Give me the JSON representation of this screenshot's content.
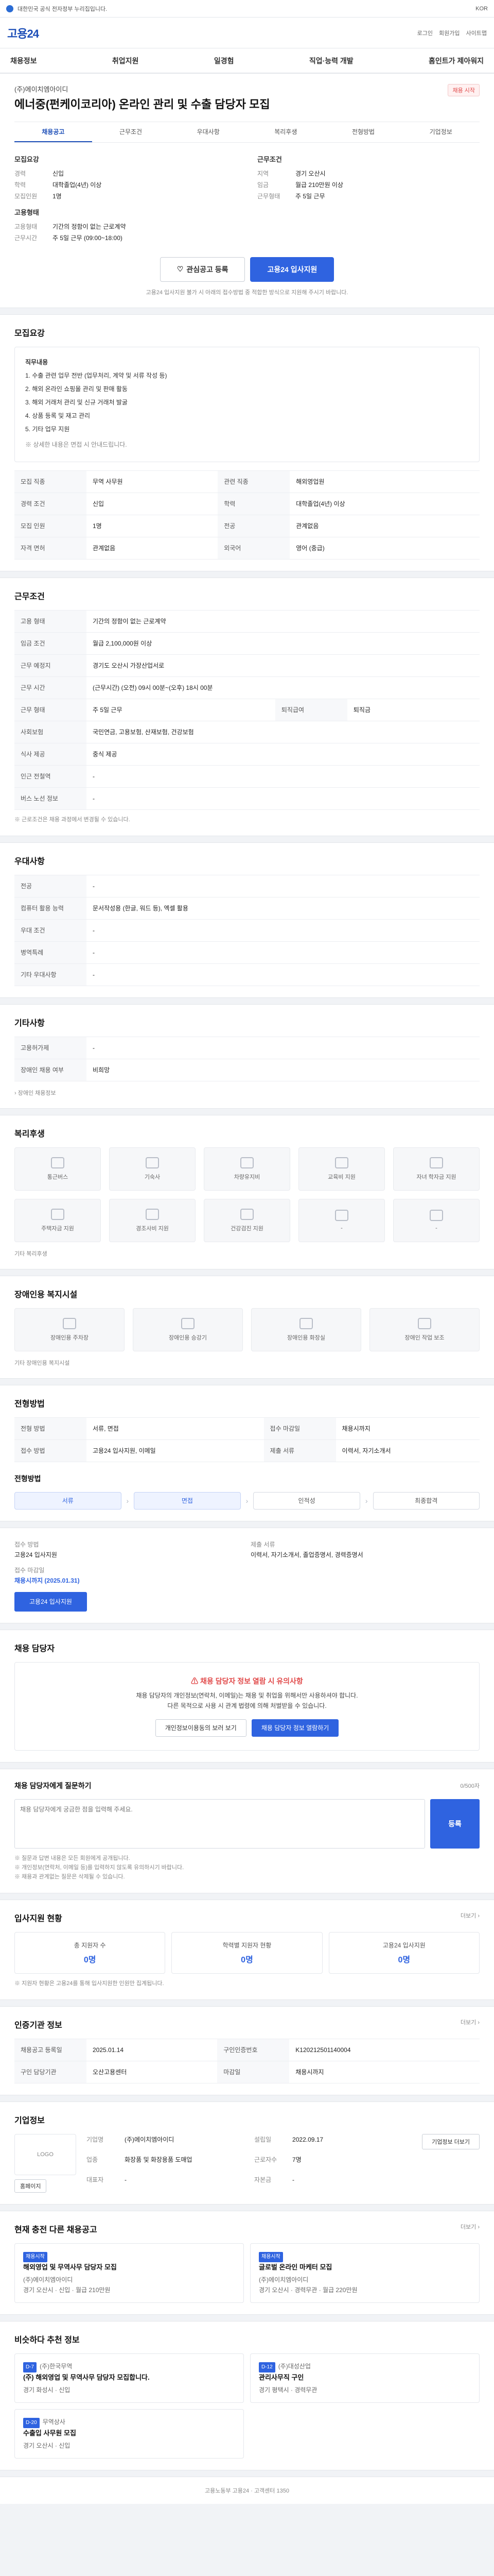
{
  "topbar": {
    "notice": "대한민국 공식 전자정부 누리집입니다.",
    "lang": "KOR"
  },
  "gnb": {
    "logo": "고용24",
    "links": [
      "로그인",
      "회원가입",
      "사이트맵"
    ]
  },
  "tabs": [
    "채용정보",
    "취업지원",
    "일경험",
    "직업·능력 개발",
    "홈인트가 제아워지"
  ],
  "job": {
    "company": "(주)에이치엠아이디",
    "title": "에너중(펀케이코리아) 온라인 관리 및 수출 담당자 모집",
    "badge": "채용 시작",
    "subnav": [
      "채용공고",
      "근무조건",
      "우대사항",
      "복리후생",
      "전형방법",
      "기업정보"
    ],
    "recruit_heading": "모집요강",
    "recruit": [
      {
        "k": "경력",
        "v": "신입"
      },
      {
        "k": "학력",
        "v": "대학졸업(4년) 이상"
      },
      {
        "k": "모집인원",
        "v": "1명"
      }
    ],
    "condition_heading": "근무조건",
    "condition": [
      {
        "k": "지역",
        "v": "경기 오산시"
      },
      {
        "k": "임금",
        "v": "월급 210만원 이상"
      },
      {
        "k": "근무형태",
        "v": "주 5일 근무"
      }
    ],
    "employ_heading": "고용형태",
    "employ": [
      {
        "k": "고용형태",
        "v": "기간의 정함이 없는 근로계약"
      },
      {
        "k": "근무시간",
        "v": "주 5일 근무 (09:00~18:00)"
      }
    ],
    "apply_buttons": {
      "scrap": "관심공고 등록",
      "apply": "고용24 입사지원"
    },
    "apply_note": "고용24 입사지원 불가 시 아래의 접수방법 중 적합한 방식으로 지원해 주시기 바랍니다."
  },
  "recruit_detail": {
    "heading": "모집요강",
    "duty_title": "직무내용",
    "duties": [
      "1. 수출 관련 업무 전반 (업무처리, 계약 및 서류 작성 등)",
      "2. 해외 온라인 쇼핑몰 관리 및 판매 활동",
      "3. 해외 거래처 관리 및 신규 거래처 발굴",
      "4. 상품 등록 및 재고 관리",
      "5. 기타 업무 지원"
    ],
    "extra": "※ 상세한 내용은 면접 시 안내드립니다.",
    "rows": [
      {
        "k": "모집 직종",
        "v": "무역 사무원"
      },
      {
        "k": "관련 직종",
        "v": "해외영업원"
      },
      {
        "k": "경력 조건",
        "v": "신입"
      },
      {
        "k": "학력",
        "v": "대학졸업(4년) 이상"
      },
      {
        "k": "모집 인원",
        "v": "1명"
      },
      {
        "k": "전공",
        "v": "관계없음"
      },
      {
        "k": "자격 면허",
        "v": "관계없음"
      },
      {
        "k": "외국어",
        "v": "영어 (중급)"
      }
    ]
  },
  "work": {
    "heading": "근무조건",
    "rows": [
      {
        "k": "고용 형태",
        "v": "기간의 정함이 없는 근로계약"
      },
      {
        "k": "임금 조건",
        "v": "월급 2,100,000원 이상"
      },
      {
        "k": "근무 예정지",
        "v": "경기도 오산시 가장산업서로"
      },
      {
        "k": "근무 시간",
        "v": "(근무시간) (오전) 09시 00분~(오후) 18시 00분"
      },
      {
        "k": "근무 형태",
        "v": "주 5일 근무"
      },
      {
        "k": "사회보험",
        "v": "국민연금, 고용보험, 산재보험, 건강보험"
      },
      {
        "k": "퇴직급여",
        "v": "퇴직금"
      }
    ],
    "rows2": [
      {
        "k": "식사 제공",
        "v": "중식 제공"
      },
      {
        "k": "인근 전철역",
        "v": "-"
      },
      {
        "k": "버스 노선 정보",
        "v": "-"
      }
    ],
    "note": "※ 근로조건은 채용 과정에서 변경될 수 있습니다."
  },
  "prefer": {
    "heading": "우대사항",
    "rows": [
      {
        "k": "전공",
        "v": "-"
      },
      {
        "k": "컴퓨터 활용 능력",
        "v": "문서작성용 (한글, 워드 등), 엑셀 활용"
      },
      {
        "k": "우대 조건",
        "v": "-"
      },
      {
        "k": "병역특례",
        "v": "-"
      },
      {
        "k": "기타 우대사항",
        "v": "-"
      }
    ]
  },
  "other": {
    "heading": "기타사항",
    "rows": [
      {
        "k": "고용허가제",
        "v": "-"
      },
      {
        "k": "장애인 채용 여부",
        "v": "비희망"
      }
    ],
    "more": "› 장애인 채용정보"
  },
  "welfare": {
    "heading": "복리후생",
    "items": [
      "통근버스",
      "기숙사",
      "차량유지비",
      "교육비 지원",
      "자녀 학자금 지원",
      "주택자금 지원",
      "경조사비 지원",
      "건강검진 지원",
      "-",
      "-"
    ],
    "more": "기타 복리후생"
  },
  "disabled": {
    "heading": "장애인용 복지시설",
    "items": [
      "장애인용 주차장",
      "장애인용 승강기",
      "장애인용 화장실",
      "장애인 작업 보조"
    ],
    "more": "기타 장애인용 복지시설"
  },
  "selection": {
    "heading": "전형방법",
    "rows": [
      {
        "k": "전형 방법",
        "v": "서류, 면접"
      },
      {
        "k": "접수 마감일",
        "v": "채용시까지"
      },
      {
        "k": "접수 방법",
        "v": "고용24 입사지원, 이메일"
      },
      {
        "k": "제출 서류",
        "v": "이력서, 자기소개서"
      }
    ],
    "steps_heading": "전형방법",
    "steps": [
      "서류",
      "면접",
      "인적성",
      "최종합격"
    ]
  },
  "apply": {
    "method_label": "접수 방법",
    "method_value": "고용24 입사지원",
    "deadline_label": "접수 마감일",
    "deadline_value": "채용시까지 (2025.01.31)",
    "doc_label": "제출 서류",
    "doc_value": "이력서, 자기소개서, 졸업증명서, 경력증명서",
    "apply_button": "고용24 입사지원"
  },
  "contact": {
    "heading": "채용 담당자",
    "alert_title": "채용 담당자 정보 열람 시 유의사항",
    "alert_text": "채용 담당자의 개인정보(연락처, 이메일)는 채용 및 취업을 위해서만 사용하셔야 합니다.",
    "alert_text2": "다른 목적으로 사용 시 관계 법령에 의해 처벌받을 수 있습니다.",
    "btn_agree": "채용 담당자 정보 열람하기",
    "btn_close": "개인정보이용동의 보러 보기"
  },
  "qa": {
    "heading": "채용 담당자에게 질문하기",
    "counter": "0/500자",
    "placeholder": "채용 담당자에게 궁금한 점을 입력해 주세요.",
    "button": "등록",
    "notes": [
      "※ 질문과 답변 내용은 모든 회원에게 공개됩니다.",
      "※ 개인정보(연락처, 이메일 등)를 입력하지 않도록 유의하시기 바랍니다.",
      "※ 채용과 관계없는 질문은 삭제될 수 있습니다."
    ]
  },
  "status": {
    "heading": "입사지원 현황",
    "more": "더보기 ›",
    "items": [
      {
        "label": "총 지원자 수",
        "value": "0명"
      },
      {
        "label": "학력별 지원자 현황",
        "value": "0명"
      },
      {
        "label": "고용24 입사지원",
        "value": "0명"
      }
    ],
    "note": "※ 지원자 현황은 고용24를 통해 입사지원한 인원만 집계됩니다."
  },
  "register": {
    "heading": "인증기관 정보",
    "more": "더보기 ›",
    "rows": [
      {
        "k": "채용공고 등록일",
        "v": "2025.01.14"
      },
      {
        "k": "구인인증번호",
        "v": "K120212501140004"
      },
      {
        "k": "구인 담당기관",
        "v": "오산고용센터"
      },
      {
        "k": "마감일",
        "v": "채용시까지"
      }
    ]
  },
  "company_info": {
    "heading": "기업정보",
    "logo": "LOGO",
    "rows": [
      {
        "k": "기업명",
        "v": "(주)에이치엠아이디"
      },
      {
        "k": "업종",
        "v": "화장품 및 화장용품 도매업"
      },
      {
        "k": "대표자",
        "v": "-"
      },
      {
        "k": "설립일",
        "v": "2022.09.17"
      },
      {
        "k": "근로자수",
        "v": "7명"
      },
      {
        "k": "자본금",
        "v": "-"
      }
    ],
    "btn_home": "홈페이지",
    "btn_more": "기업정보 더보기"
  },
  "related": {
    "heading": "현재 충전 다른 채용공고",
    "more": "더보기 ›",
    "items": [
      {
        "tag": "채용시작",
        "title": "해외영업 및 무역사무 담당자 모집",
        "company": "(주)에이치엠아이디",
        "meta": "경기 오산시 · 신입 · 월급 210만원"
      },
      {
        "tag": "채용시작",
        "title": "글로벌 온라인 마케터 모집",
        "company": "(주)에이치엠아이디",
        "meta": "경기 오산시 · 경력무관 · 월급 220만원"
      }
    ]
  },
  "recommend": {
    "heading": "비슷하다 추천 정보",
    "items": [
      {
        "tag": "D-7",
        "title": "(주) 해외영업 및 무역사무 담당자 모집합니다.",
        "company": "(주)한국무역",
        "meta": "경기 화성시 · 신입"
      },
      {
        "tag": "D-12",
        "title": "관리사무직 구인",
        "company": "(주)대성산업",
        "meta": "경기 평택시 · 경력무관"
      },
      {
        "tag": "D-20",
        "title": "수출입 사무원 모집",
        "company": "무역상사",
        "meta": "경기 오산시 · 신입"
      }
    ]
  },
  "footer": {
    "text": "고용노동부 고용24 · 고객센터 1350"
  }
}
